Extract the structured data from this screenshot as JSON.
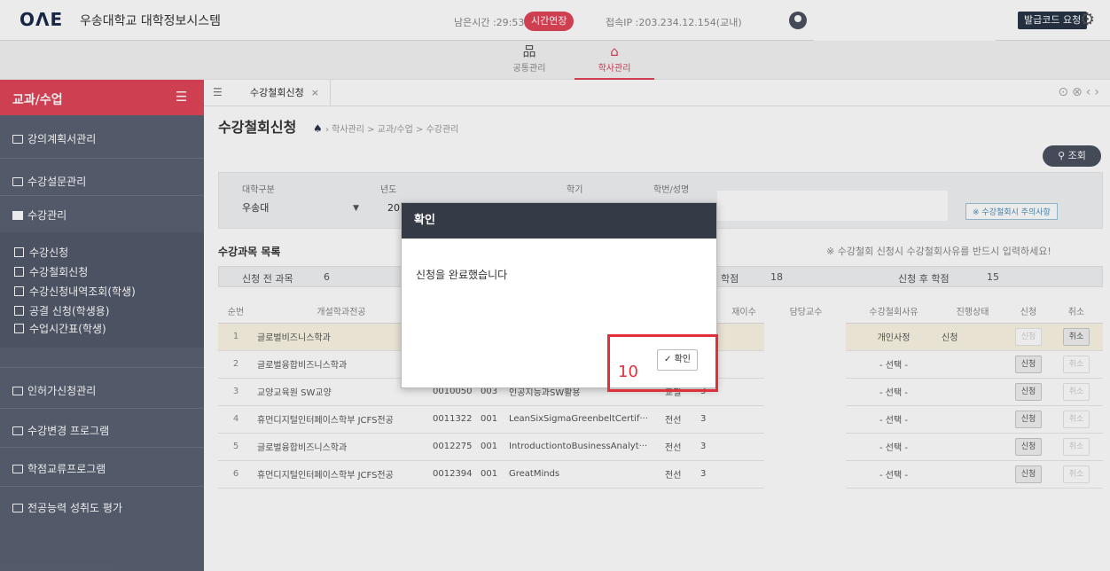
{
  "header": {
    "logo": "ОΛΕ",
    "app_name": "우송대학교 대학정보시스템",
    "remaining_time": "남은시간 :29:53",
    "extend_label": "시간연장",
    "ip_info": "접속IP :203.234.12.154(교내)",
    "code_button": "발급코드 요청"
  },
  "menu": {
    "tabs": [
      {
        "label": "공통관리",
        "icon": "network-icon"
      },
      {
        "label": "학사관리",
        "icon": "graduation-cap-icon",
        "active": true
      }
    ]
  },
  "sidebar": {
    "title": "교과/수업",
    "groups": [
      {
        "label": "강의계획서관리"
      },
      {
        "label": "수강설문관리"
      },
      {
        "label": "수강관리"
      }
    ],
    "subitems": [
      {
        "label": "수강신청"
      },
      {
        "label": "수강철회신청"
      },
      {
        "label": "수강신청내역조회(학생)"
      },
      {
        "label": "공결 신청(학생용)"
      },
      {
        "label": "수업시간표(학생)"
      }
    ],
    "groups2": [
      {
        "label": "인허가신청관리"
      },
      {
        "label": "수강변경 프로그램"
      },
      {
        "label": "학점교류프로그램"
      },
      {
        "label": "전공능력 성취도 평가"
      }
    ]
  },
  "content": {
    "tab_label": "수강철회신청",
    "page_title": "수강철회신청",
    "breadcrumb": "학사관리 > 교과/수업 > 수강관리",
    "search_button": "조회",
    "filter": {
      "univ_label": "대학구분",
      "univ_value": "우송대",
      "year_label": "년도",
      "year_value": "20",
      "term_label": "학기",
      "student_label": "학번/성명",
      "notice_button": "※ 수강철회시 주의사항"
    },
    "list_title": "수강과목 목록",
    "warning": "※ 수강철회 신청시 수강철회사유를 반드시 입력하세요!",
    "summary": {
      "before_label": "신청 전 과목",
      "before_value": "6",
      "credit_label": "학점",
      "credit_value": "18",
      "after_label": "신청 후 학점",
      "after_value": "15"
    },
    "table": {
      "headers": [
        "순번",
        "개설학과전공",
        "",
        "",
        "",
        "",
        "재이수",
        "담당교수",
        "수강철회사유",
        "진행상태",
        "신청",
        "취소"
      ],
      "rows": [
        {
          "no": "1",
          "dept": "글로벌비즈니스학과",
          "code": "",
          "sec": "",
          "title": "",
          "type": "",
          "credit": "",
          "reason": "개인사정",
          "status": "신청",
          "apply": "신청",
          "cancel": "취소"
        },
        {
          "no": "2",
          "dept": "글로벌융합비즈니스학과",
          "code": "",
          "sec": "",
          "title": "",
          "type": "",
          "credit": "",
          "reason": "- 선택 -",
          "status": "",
          "apply": "신청",
          "cancel": "취소"
        },
        {
          "no": "3",
          "dept": "교양교육원 SW교양",
          "code": "0010050",
          "sec": "003",
          "title": "인공지능과SW활용",
          "type": "교필",
          "credit": "3",
          "reason": "- 선택 -",
          "status": "",
          "apply": "신청",
          "cancel": "취소"
        },
        {
          "no": "4",
          "dept": "휴먼디지털인터페이스학부 JCFS전공",
          "code": "0011322",
          "sec": "001",
          "title": "LeanSixSigmaGreenbeltCertif···",
          "type": "전선",
          "credit": "3",
          "reason": "- 선택 -",
          "status": "",
          "apply": "신청",
          "cancel": "취소"
        },
        {
          "no": "5",
          "dept": "글로벌융합비즈니스학과",
          "code": "0012275",
          "sec": "001",
          "title": "IntroductiontoBusinessAnalyt···",
          "type": "전선",
          "credit": "3",
          "reason": "- 선택 -",
          "status": "",
          "apply": "신청",
          "cancel": "취소"
        },
        {
          "no": "6",
          "dept": "휴먼디지털인터페이스학부 JCFS전공",
          "code": "0012394",
          "sec": "001",
          "title": "GreatMinds",
          "type": "전선",
          "credit": "3",
          "reason": "- 선택 -",
          "status": "",
          "apply": "신청",
          "cancel": "취소"
        }
      ]
    }
  },
  "modal": {
    "title": "확인",
    "message": "신청을 완료했습니다",
    "ok_button": "✓ 확인"
  },
  "annotation": {
    "step": "10",
    "color": "#e0303a"
  }
}
